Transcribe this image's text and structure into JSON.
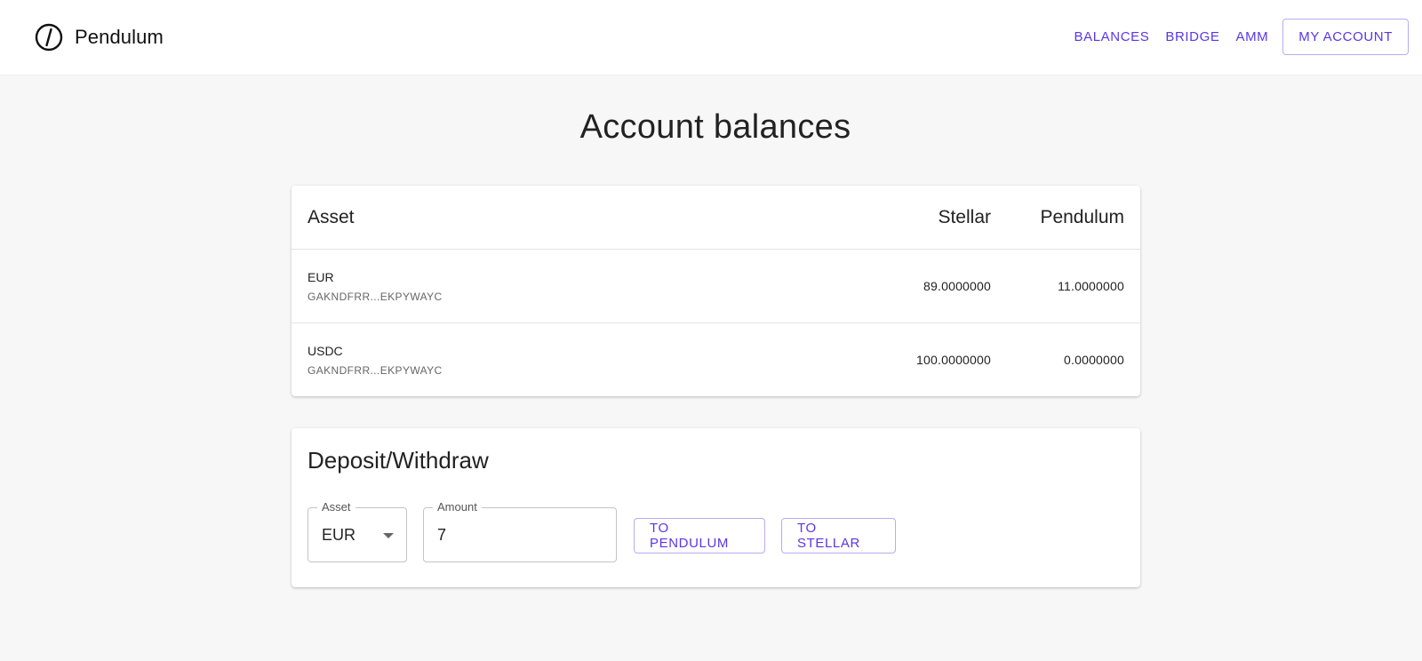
{
  "app": {
    "brand_name": "Pendulum",
    "logo_icon": "pendulum-logo-icon"
  },
  "nav": {
    "links": [
      "BALANCES",
      "BRIDGE",
      "AMM"
    ],
    "account_button": "MY ACCOUNT"
  },
  "colors": {
    "accent": "#5a36e6",
    "background": "#f7f7f7",
    "card": "#ffffff"
  },
  "page": {
    "title": "Account balances"
  },
  "balances_table": {
    "headers": {
      "asset": "Asset",
      "stellar": "Stellar",
      "pendulum": "Pendulum"
    },
    "rows": [
      {
        "code": "EUR",
        "issuer": "GAKNDFRR...EKPYWAYC",
        "stellar": "89.0000000",
        "pendulum": "11.0000000"
      },
      {
        "code": "USDC",
        "issuer": "GAKNDFRR...EKPYWAYC",
        "stellar": "100.0000000",
        "pendulum": "0.0000000"
      }
    ]
  },
  "deposit": {
    "title": "Deposit/Withdraw",
    "asset_label": "Asset",
    "asset_value": "EUR",
    "amount_label": "Amount",
    "amount_value": "7",
    "to_pendulum_label": "TO PENDULUM",
    "to_stellar_label": "TO STELLAR"
  }
}
